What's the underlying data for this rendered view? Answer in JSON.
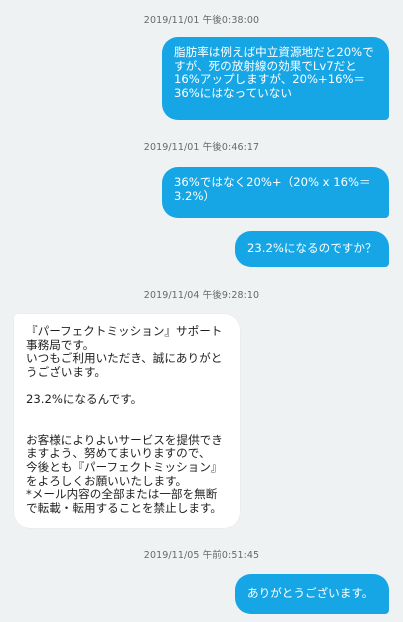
{
  "messages": [
    {
      "timestamp": "2019/11/01 午後0:38:00",
      "direction": "out",
      "lines": [
        "脂肪率は例えば中立資源地だと20%で",
        "すが、死の放射線の効果でLv7だと",
        "16%アップしますが、20%+16%＝",
        "36%にはなっていない"
      ]
    },
    {
      "timestamp": "2019/11/01 午後0:46:17",
      "direction": "out",
      "lines": [
        "36%ではなく20%+（20% x 16%＝",
        "3.2%）"
      ]
    },
    {
      "direction": "out",
      "lines": [
        "23.2%になるのですか？"
      ]
    },
    {
      "timestamp": "2019/11/04 午後9:28:10",
      "direction": "in",
      "lines": [
        "『パーフェクトミッション』サポート",
        "事務局です。",
        "いつもご利用いただき、誠にありがと",
        "うございます。",
        "",
        "23.2%になるんです。",
        "",
        "",
        "お客様によりよいサービスを提供でき",
        "ますよう、努めてまいりますので、",
        "今後とも『パーフェクトミッション』",
        "をよろしくお願いいたします。",
        "*メール内容の全部または一部を無断",
        "で転載・転用することを禁止します。"
      ]
    },
    {
      "timestamp": "2019/11/05 午前0:51:45",
      "direction": "out",
      "lines": [
        "ありがとうございます。"
      ]
    }
  ]
}
